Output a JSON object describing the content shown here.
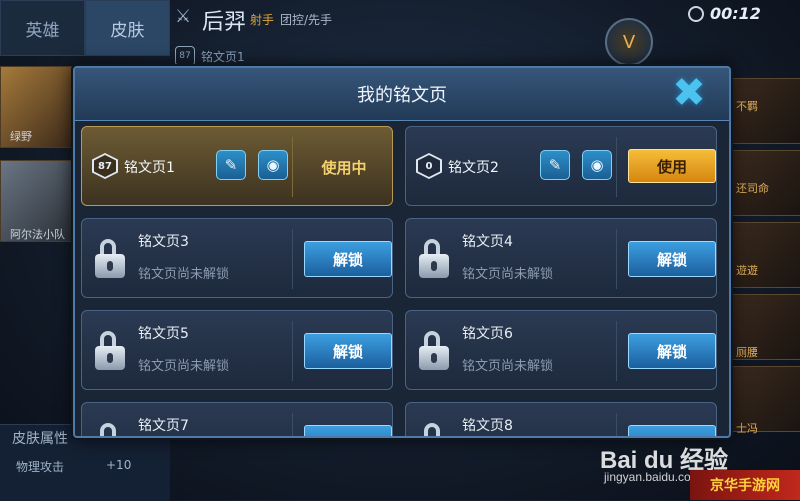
{
  "background": {
    "tabs": [
      "英雄",
      "皮肤"
    ],
    "hero": {
      "name": "后羿",
      "role": "射手",
      "tags": "团控/先手"
    },
    "page_chip": {
      "level": "87",
      "label": "铭文页1"
    },
    "timer": "00:12",
    "emblem_letter": "V",
    "left_labels": [
      "绿野",
      "阿尔法小队"
    ],
    "right_labels": [
      "不羁",
      "还司命",
      "遊遊",
      "厕腰",
      "士冯"
    ],
    "skin_attr": {
      "title": "皮肤属性",
      "stat_label": "物理攻击",
      "stat_value": "+10"
    }
  },
  "dialog": {
    "title": "我的铭文页",
    "close_icon": "close-x-icon",
    "pages": [
      {
        "level": "87",
        "name": "铭文页1",
        "state": "in_use",
        "status_label": "使用中"
      },
      {
        "level": "0",
        "name": "铭文页2",
        "state": "available",
        "action_label": "使用"
      },
      {
        "name": "铭文页3",
        "state": "locked",
        "sub": "铭文页尚未解锁",
        "action_label": "解锁"
      },
      {
        "name": "铭文页4",
        "state": "locked",
        "sub": "铭文页尚未解锁",
        "action_label": "解锁"
      },
      {
        "name": "铭文页5",
        "state": "locked",
        "sub": "铭文页尚未解锁",
        "action_label": "解锁"
      },
      {
        "name": "铭文页6",
        "state": "locked",
        "sub": "铭文页尚未解锁",
        "action_label": "解锁"
      },
      {
        "name": "铭文页7",
        "state": "locked",
        "action_label": "解锁"
      },
      {
        "name": "铭文页8",
        "state": "locked",
        "action_label": "解锁"
      }
    ]
  },
  "watermark": {
    "logo": "Bai du 经验",
    "url": "jingyan.baidu.com",
    "site": "京华手游网"
  },
  "colors": {
    "accent_blue": "#2e8fc9",
    "accent_gold": "#f4d26e",
    "use_button": "#f6bd3a"
  }
}
